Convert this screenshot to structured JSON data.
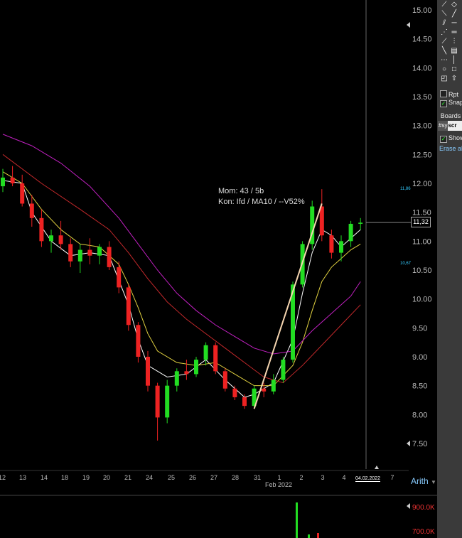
{
  "chart_data": {
    "type": "candlestick",
    "x_ticks": [
      "12",
      "13",
      "14",
      "18",
      "19",
      "20",
      "21",
      "24",
      "25",
      "26",
      "27",
      "28",
      "31",
      "1",
      "2",
      "3",
      "4",
      "7"
    ],
    "x_month_label": "Feb 2022",
    "y_ticks": [
      "15.00",
      "14.50",
      "14.00",
      "13.50",
      "13.00",
      "12.50",
      "12.00",
      "11.50",
      "11.00",
      "10.50",
      "10.00",
      "9.50",
      "9.00",
      "8.50",
      "8.00",
      "7.50"
    ],
    "ylim": [
      7.3,
      15.15
    ],
    "scale": "Arith",
    "annotation": [
      "Mom: 43 / 5b",
      "Kon: Ifd / MA10 / --V52%"
    ],
    "last_price": "11,32",
    "marker_high": "11,86",
    "marker_low": "10,67",
    "current_date": "04.02.2022",
    "volume_ticks": [
      "900.0K",
      "700.0K"
    ],
    "candles": [
      [
        11.95,
        12.25,
        11.85,
        12.1
      ],
      [
        12.1,
        12.3,
        11.95,
        12.0
      ],
      [
        12.0,
        12.15,
        11.6,
        11.65
      ],
      [
        11.65,
        11.8,
        11.25,
        11.4
      ],
      [
        11.4,
        11.55,
        10.9,
        11.0
      ],
      [
        11.0,
        11.2,
        10.8,
        11.1
      ],
      [
        11.1,
        11.35,
        10.85,
        10.95
      ],
      [
        10.95,
        11.05,
        10.55,
        10.65
      ],
      [
        10.65,
        10.95,
        10.45,
        10.85
      ],
      [
        10.85,
        11.05,
        10.6,
        10.75
      ],
      [
        10.75,
        10.95,
        10.6,
        10.9
      ],
      [
        10.9,
        11.0,
        10.5,
        10.55
      ],
      [
        10.55,
        10.65,
        10.1,
        10.2
      ],
      [
        10.2,
        10.25,
        9.45,
        9.55
      ],
      [
        9.55,
        9.6,
        8.9,
        9.0
      ],
      [
        9.0,
        9.1,
        8.4,
        8.5
      ],
      [
        8.5,
        8.55,
        7.55,
        7.95
      ],
      [
        7.95,
        8.6,
        7.85,
        8.5
      ],
      [
        8.5,
        8.8,
        8.4,
        8.75
      ],
      [
        8.75,
        8.95,
        8.6,
        8.7
      ],
      [
        8.7,
        9.0,
        8.65,
        8.95
      ],
      [
        8.95,
        9.25,
        8.85,
        9.2
      ],
      [
        9.2,
        9.25,
        8.7,
        8.75
      ],
      [
        8.75,
        8.8,
        8.4,
        8.45
      ],
      [
        8.45,
        8.5,
        8.25,
        8.3
      ],
      [
        8.3,
        8.35,
        8.1,
        8.15
      ],
      [
        8.15,
        8.5,
        8.1,
        8.45
      ],
      [
        8.45,
        8.55,
        8.3,
        8.4
      ],
      [
        8.4,
        8.7,
        8.35,
        8.6
      ],
      [
        8.6,
        9.0,
        8.55,
        8.95
      ],
      [
        8.95,
        10.3,
        8.9,
        10.25
      ],
      [
        10.25,
        11.0,
        10.2,
        10.95
      ],
      [
        10.95,
        11.7,
        10.85,
        11.6
      ],
      [
        11.6,
        11.9,
        11.0,
        11.1
      ],
      [
        11.1,
        11.2,
        10.7,
        10.8
      ],
      [
        10.8,
        11.1,
        10.65,
        11.0
      ],
      [
        11.0,
        11.35,
        10.9,
        11.3
      ],
      [
        11.3,
        11.4,
        11.2,
        11.32
      ]
    ],
    "series": [
      {
        "color": "#ffffff",
        "values": [
          [
            0,
            12.05
          ],
          [
            2,
            12.0
          ],
          [
            3,
            11.5
          ],
          [
            5,
            11.0
          ],
          [
            7,
            10.75
          ],
          [
            9,
            10.8
          ],
          [
            11,
            10.75
          ],
          [
            13,
            9.9
          ],
          [
            14,
            9.3
          ],
          [
            15,
            8.85
          ],
          [
            17,
            8.65
          ],
          [
            19,
            8.7
          ],
          [
            21,
            8.95
          ],
          [
            23,
            8.6
          ],
          [
            25,
            8.3
          ],
          [
            26,
            8.35
          ],
          [
            28,
            8.55
          ],
          [
            30,
            9.3
          ],
          [
            31,
            10.1
          ],
          [
            32,
            10.8
          ],
          [
            33,
            11.2
          ],
          [
            34,
            11.1
          ],
          [
            35,
            10.9
          ],
          [
            36,
            11.05
          ],
          [
            37,
            11.2
          ]
        ]
      },
      {
        "color": "#e0d040",
        "values": [
          [
            0,
            12.2
          ],
          [
            2,
            12.0
          ],
          [
            4,
            11.55
          ],
          [
            6,
            11.2
          ],
          [
            8,
            10.95
          ],
          [
            10,
            10.9
          ],
          [
            12,
            10.6
          ],
          [
            13,
            10.25
          ],
          [
            14,
            9.85
          ],
          [
            15,
            9.4
          ],
          [
            16,
            9.1
          ],
          [
            18,
            8.9
          ],
          [
            20,
            8.85
          ],
          [
            22,
            8.9
          ],
          [
            24,
            8.7
          ],
          [
            26,
            8.5
          ],
          [
            28,
            8.5
          ],
          [
            30,
            8.85
          ],
          [
            31,
            9.25
          ],
          [
            32,
            9.8
          ],
          [
            33,
            10.3
          ],
          [
            34,
            10.55
          ],
          [
            35,
            10.7
          ],
          [
            36,
            10.85
          ],
          [
            37,
            10.95
          ]
        ]
      },
      {
        "color": "#c0282a",
        "values": [
          [
            0,
            12.5
          ],
          [
            4,
            12.0
          ],
          [
            8,
            11.55
          ],
          [
            11,
            11.2
          ],
          [
            13,
            10.8
          ],
          [
            15,
            10.35
          ],
          [
            17,
            9.95
          ],
          [
            19,
            9.65
          ],
          [
            21,
            9.4
          ],
          [
            23,
            9.15
          ],
          [
            25,
            8.9
          ],
          [
            27,
            8.65
          ],
          [
            29,
            8.55
          ],
          [
            31,
            8.85
          ],
          [
            33,
            9.2
          ],
          [
            35,
            9.55
          ],
          [
            37,
            9.9
          ]
        ]
      },
      {
        "color": "#c020c0",
        "values": [
          [
            0,
            12.85
          ],
          [
            3,
            12.65
          ],
          [
            6,
            12.35
          ],
          [
            9,
            11.95
          ],
          [
            12,
            11.4
          ],
          [
            14,
            10.95
          ],
          [
            16,
            10.5
          ],
          [
            18,
            10.1
          ],
          [
            20,
            9.8
          ],
          [
            22,
            9.55
          ],
          [
            24,
            9.35
          ],
          [
            26,
            9.15
          ],
          [
            28,
            9.05
          ],
          [
            30,
            9.1
          ],
          [
            32,
            9.45
          ],
          [
            34,
            9.75
          ],
          [
            36,
            10.05
          ],
          [
            37,
            10.3
          ]
        ]
      }
    ],
    "trendline": [
      [
        26,
        8.1
      ],
      [
        33,
        11.65
      ]
    ]
  },
  "panel": {
    "rpt_label": "Rpt",
    "snap_label": "Snap",
    "boards_label": "Boards",
    "scr_prefix": "#sy",
    "scr_label": "scr",
    "show_label": "Show",
    "erase_label": "Erase all"
  }
}
